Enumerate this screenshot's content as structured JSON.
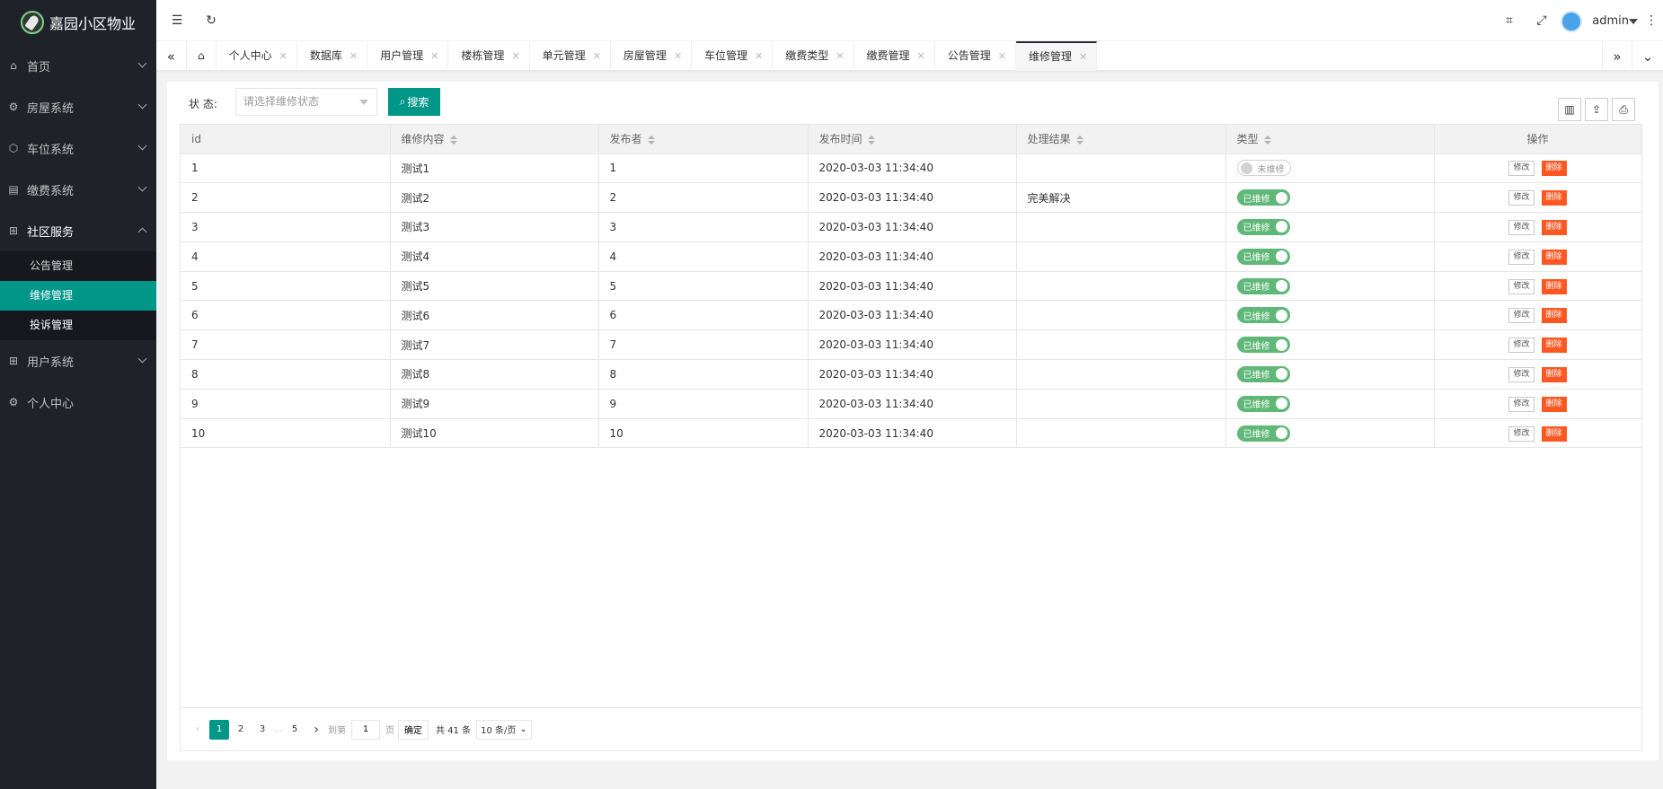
{
  "app": {
    "title": "嘉园小区物业"
  },
  "colors": {
    "accent": "#009688",
    "sidebar_bg": "#20222a",
    "danger": "#ff5722",
    "switch_on": "#5fb878"
  },
  "sidebar": {
    "items": [
      {
        "label": "首页",
        "icon": "home-icon"
      },
      {
        "label": "房屋系统",
        "icon": "gear-icon"
      },
      {
        "label": "车位系统",
        "icon": "cube-icon"
      },
      {
        "label": "缴费系统",
        "icon": "book-icon"
      },
      {
        "label": "社区服务",
        "icon": "grid-icon"
      },
      {
        "label": "用户系统",
        "icon": "grid-icon"
      },
      {
        "label": "个人中心",
        "icon": "gear-icon"
      }
    ],
    "sub_items": [
      {
        "label": "公告管理"
      },
      {
        "label": "维修管理"
      },
      {
        "label": "投诉管理"
      }
    ]
  },
  "header": {
    "user": "admin"
  },
  "tabs": [
    {
      "label": "个人中心"
    },
    {
      "label": "数据库"
    },
    {
      "label": "用户管理"
    },
    {
      "label": "楼栋管理"
    },
    {
      "label": "单元管理"
    },
    {
      "label": "房屋管理"
    },
    {
      "label": "车位管理"
    },
    {
      "label": "缴费类型"
    },
    {
      "label": "缴费管理"
    },
    {
      "label": "公告管理"
    },
    {
      "label": "维修管理"
    }
  ],
  "filter": {
    "status_label": "状 态:",
    "status_placeholder": "请选择维修状态",
    "search_label": "搜索"
  },
  "table": {
    "columns": [
      "id",
      "维修内容",
      "发布者",
      "发布时间",
      "处理结果",
      "类型",
      "操作"
    ],
    "rows": [
      {
        "id": "1",
        "content": "测试1",
        "publisher": "1",
        "time": "2020-03-03 11:34:40",
        "result": "",
        "type": "未维修",
        "on": false
      },
      {
        "id": "2",
        "content": "测试2",
        "publisher": "2",
        "time": "2020-03-03 11:34:40",
        "result": "完美解决",
        "type": "已维修",
        "on": true
      },
      {
        "id": "3",
        "content": "测试3",
        "publisher": "3",
        "time": "2020-03-03 11:34:40",
        "result": "",
        "type": "已维修",
        "on": true
      },
      {
        "id": "4",
        "content": "测试4",
        "publisher": "4",
        "time": "2020-03-03 11:34:40",
        "result": "",
        "type": "已维修",
        "on": true
      },
      {
        "id": "5",
        "content": "测试5",
        "publisher": "5",
        "time": "2020-03-03 11:34:40",
        "result": "",
        "type": "已维修",
        "on": true
      },
      {
        "id": "6",
        "content": "测试6",
        "publisher": "6",
        "time": "2020-03-03 11:34:40",
        "result": "",
        "type": "已维修",
        "on": true
      },
      {
        "id": "7",
        "content": "测试7",
        "publisher": "7",
        "time": "2020-03-03 11:34:40",
        "result": "",
        "type": "已维修",
        "on": true
      },
      {
        "id": "8",
        "content": "测试8",
        "publisher": "8",
        "time": "2020-03-03 11:34:40",
        "result": "",
        "type": "已维修",
        "on": true
      },
      {
        "id": "9",
        "content": "测试9",
        "publisher": "9",
        "time": "2020-03-03 11:34:40",
        "result": "",
        "type": "已维修",
        "on": true
      },
      {
        "id": "10",
        "content": "测试10",
        "publisher": "10",
        "time": "2020-03-03 11:34:40",
        "result": "",
        "type": "已维修",
        "on": true
      }
    ],
    "edit_label": "修改",
    "delete_label": "删除"
  },
  "pager": {
    "pages": [
      "1",
      "2",
      "3",
      "…",
      "5"
    ],
    "current": "1",
    "goto_label": "到第",
    "goto_value": "1",
    "page_unit": "页",
    "confirm_label": "确定",
    "total": "共 41 条",
    "limit": "10 条/页"
  }
}
